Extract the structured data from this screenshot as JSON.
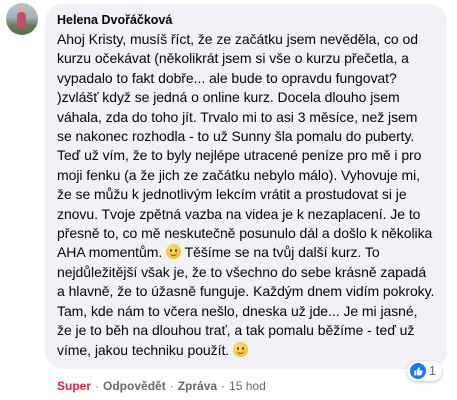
{
  "comment": {
    "author": "Helena Dvořáčková",
    "text": "Ahoj Kristy, musíš říct, že ze začátku jsem nevěděla, co od kurzu očekávat (několikrát jsem si vše o kurzu přečetla, a vypadalo to fakt dobře... ale bude to opravdu fungovat? )zvlášť když se jedná o online kurz. Docela dlouho jsem váhala, zda do toho jít. Trvalo mi to asi 3 měsíce, než jsem se nakonec rozhodla - to už Sunny šla pomalu do puberty. Teď už vím, že to byly nejlépe utracené peníze pro mě i pro moji fenku (a že jich ze začátku nebylo málo). Vyhovuje mi, že se můžu k jednotlivým lekcím vrátit a prostudovat si je znovu. Tvoje zpětná vazba na videa je k nezaplacení. Je to přesně to, co mě neskutečně posunulo dál a došlo k několika AHA momentům.",
    "text2": "Těšíme se na tvůj další kurz. To nejdůležitější však je, že to všechno do sebe krásně zapadá a hlavně, že to úžasně funguje. Každým dnem vidím pokroky. Tam, kde nám to včera nešlo, dneska už jde... Je mi jasné, že je to běh na dlouhou trať, a tak pomalu běžíme - teď už víme, jakou techniku použít.",
    "emoji": "smile-emoji"
  },
  "reactions": {
    "icon": "like-icon",
    "count": "1",
    "color": "#1877f2"
  },
  "actions": {
    "reaction_label": "Super",
    "reply_label": "Odpovědět",
    "message_label": "Zpráva",
    "time": "15 hod",
    "separator": "·"
  },
  "colors": {
    "bubble": "#f0f2f5",
    "text": "#050505",
    "secondary": "#65676b",
    "reaction_active": "#e41e3f"
  }
}
